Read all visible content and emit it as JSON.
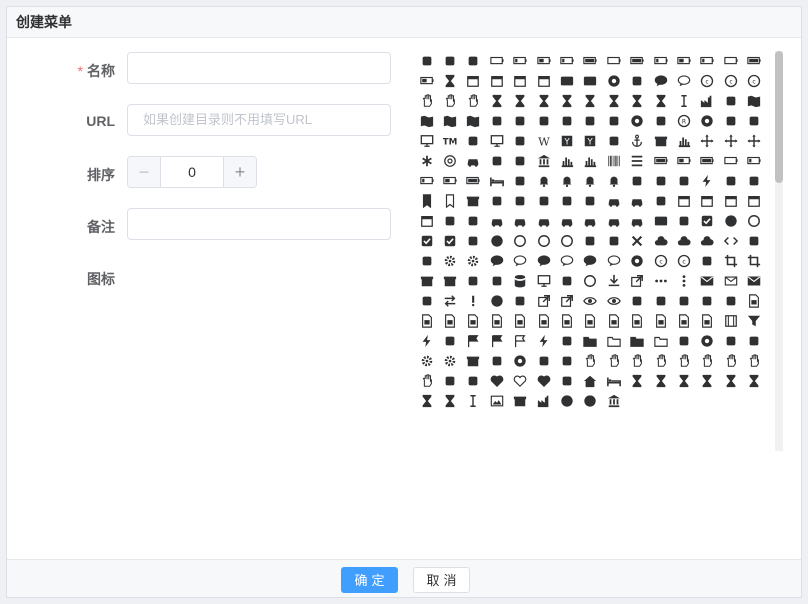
{
  "dialog": {
    "title": "创建菜单"
  },
  "form": {
    "name_label": "名称",
    "name_value": "",
    "url_label": "URL",
    "url_placeholder": "如果创建目录则不用填写URL",
    "order_label": "排序",
    "order_value": "0",
    "order_minus": "−",
    "order_plus": "+",
    "remark_label": "备注",
    "remark_value": "",
    "icon_label": "图标"
  },
  "icons": [
    "500px",
    "amazon",
    "balance-scale",
    "battery-empty",
    "battery-quarter",
    "battery-half",
    "battery-three-quarters",
    "battery-full",
    "battery-empty",
    "battery-full",
    "battery-three-quarters",
    "battery-half",
    "battery-quarter",
    "battery-empty",
    "battery-full",
    "battery-half",
    "hourglass",
    "calendar-check",
    "calendar-minus",
    "calendar-plus",
    "calendar-times",
    "cc-diners",
    "cc-jcb",
    "chrome",
    "clone",
    "commenting",
    "commenting-o",
    "creative-commons",
    "creative-commons",
    "copyright",
    "hand-pointer",
    "hand-paper",
    "hand-lizard",
    "hourglass",
    "hourglass-end",
    "hourglass-half",
    "hourglass-start",
    "hourglass-o",
    "hourglass",
    "hourglass-start",
    "hourglass",
    "i-cursor",
    "industry",
    "internet-explorer",
    "map",
    "map-o",
    "map-pin",
    "map-signs",
    "mouse-pointer",
    "object-group",
    "object-ungroup",
    "odnoklassniki",
    "odnoklassniki-square",
    "opencart",
    "opera",
    "optin-monster",
    "registered",
    "safari",
    "sticky-note",
    "sticky-note-o",
    "television",
    "trademark",
    "tripadvisor",
    "tv",
    "vimeo",
    "wikipedia",
    "y-combinator",
    "yc",
    "adjust",
    "anchor",
    "archive",
    "area-chart",
    "arrows",
    "arrows-h",
    "arrows-v",
    "asterisk",
    "at",
    "automobile",
    "balance-scale",
    "ban",
    "bank",
    "bar-chart",
    "bar-chart-o",
    "barcode",
    "bars",
    "battery",
    "battery-half",
    "battery-full",
    "battery-empty",
    "battery-quarter",
    "battery-three-quarters",
    "battery-half",
    "battery-full",
    "bed",
    "beer",
    "bell",
    "bell-o",
    "bell-slash",
    "bell-slash-o",
    "bicycle",
    "binoculars",
    "birthday-cake",
    "bolt",
    "bomb",
    "book",
    "bookmark",
    "bookmark-o",
    "briefcase",
    "bug",
    "building",
    "building-o",
    "bullhorn",
    "bullseye",
    "bus",
    "cab",
    "calculator",
    "calendar",
    "calendar-check",
    "calendar-minus",
    "calendar-plus",
    "calendar-times",
    "camera",
    "camera-retro",
    "car",
    "caret-square-down",
    "caret-square-left",
    "caret-square-right",
    "caret-square-up",
    "cart-arrow-down",
    "cart-plus",
    "cc",
    "certificate",
    "check",
    "check-circle",
    "check-circle-o",
    "check-square",
    "check-square-o",
    "child",
    "circle",
    "circle-o",
    "circle-o-notch",
    "circle-thin",
    "clock-o",
    "clone",
    "close",
    "cloud",
    "cloud-download",
    "cloud-upload",
    "code",
    "code-fork",
    "coffee",
    "cog",
    "cogs",
    "comment",
    "comment-o",
    "commenting",
    "commenting-o",
    "comments",
    "comments-o",
    "compass",
    "copyright",
    "creative-commons",
    "credit-card",
    "crop",
    "crosshairs",
    "cube",
    "cubes",
    "cutlery",
    "dashboard",
    "database",
    "desktop",
    "diamond",
    "dot-circle-o",
    "download",
    "edit",
    "ellipsis-h",
    "ellipsis-v",
    "envelope",
    "envelope-o",
    "envelope-square",
    "eraser",
    "exchange",
    "exclamation",
    "exclamation-circle",
    "exclamation-triangle",
    "external-link",
    "external-link-square",
    "eye",
    "eye-slash",
    "eyedropper",
    "fax",
    "feed",
    "female",
    "fighter-jet",
    "file-archive-o",
    "file-audio-o",
    "file-code-o",
    "file-excel-o",
    "file-image-o",
    "file-movie-o",
    "file-pdf-o",
    "file-photo-o",
    "file-picture-o",
    "file-powerpoint-o",
    "file-sound-o",
    "file-video-o",
    "file-word-o",
    "file-zip-o",
    "film",
    "filter",
    "fire",
    "fire-extinguisher",
    "flag",
    "flag-checkered",
    "flag-o",
    "flash",
    "flask",
    "folder",
    "folder-o",
    "folder-open",
    "folder-open-o",
    "frown-o",
    "futbol-o",
    "gamepad",
    "gavel",
    "gear",
    "gears",
    "gift",
    "glass",
    "globe",
    "graduation-cap",
    "group",
    "hand-grab-o",
    "hand-lizard-o",
    "hand-paper-o",
    "hand-peace-o",
    "hand-pointer-o",
    "hand-rock-o",
    "hand-scissors-o",
    "hand-spock-o",
    "hand-stop-o",
    "hdd-o",
    "headphones",
    "heart",
    "heart-o",
    "heartbeat",
    "history",
    "home",
    "hotel",
    "hourglass",
    "hourglass-1",
    "hourglass-2",
    "hourglass-3",
    "hourglass-end",
    "hourglass-half",
    "hourglass-o",
    "hourglass-start",
    "i-cursor",
    "image",
    "inbox",
    "industry",
    "info",
    "info-circle",
    "institution"
  ],
  "buttons": {
    "confirm": "确定",
    "cancel": "取消"
  },
  "colors": {
    "primary": "#409eff",
    "required": "#f56c6c",
    "icon": "#303133"
  }
}
